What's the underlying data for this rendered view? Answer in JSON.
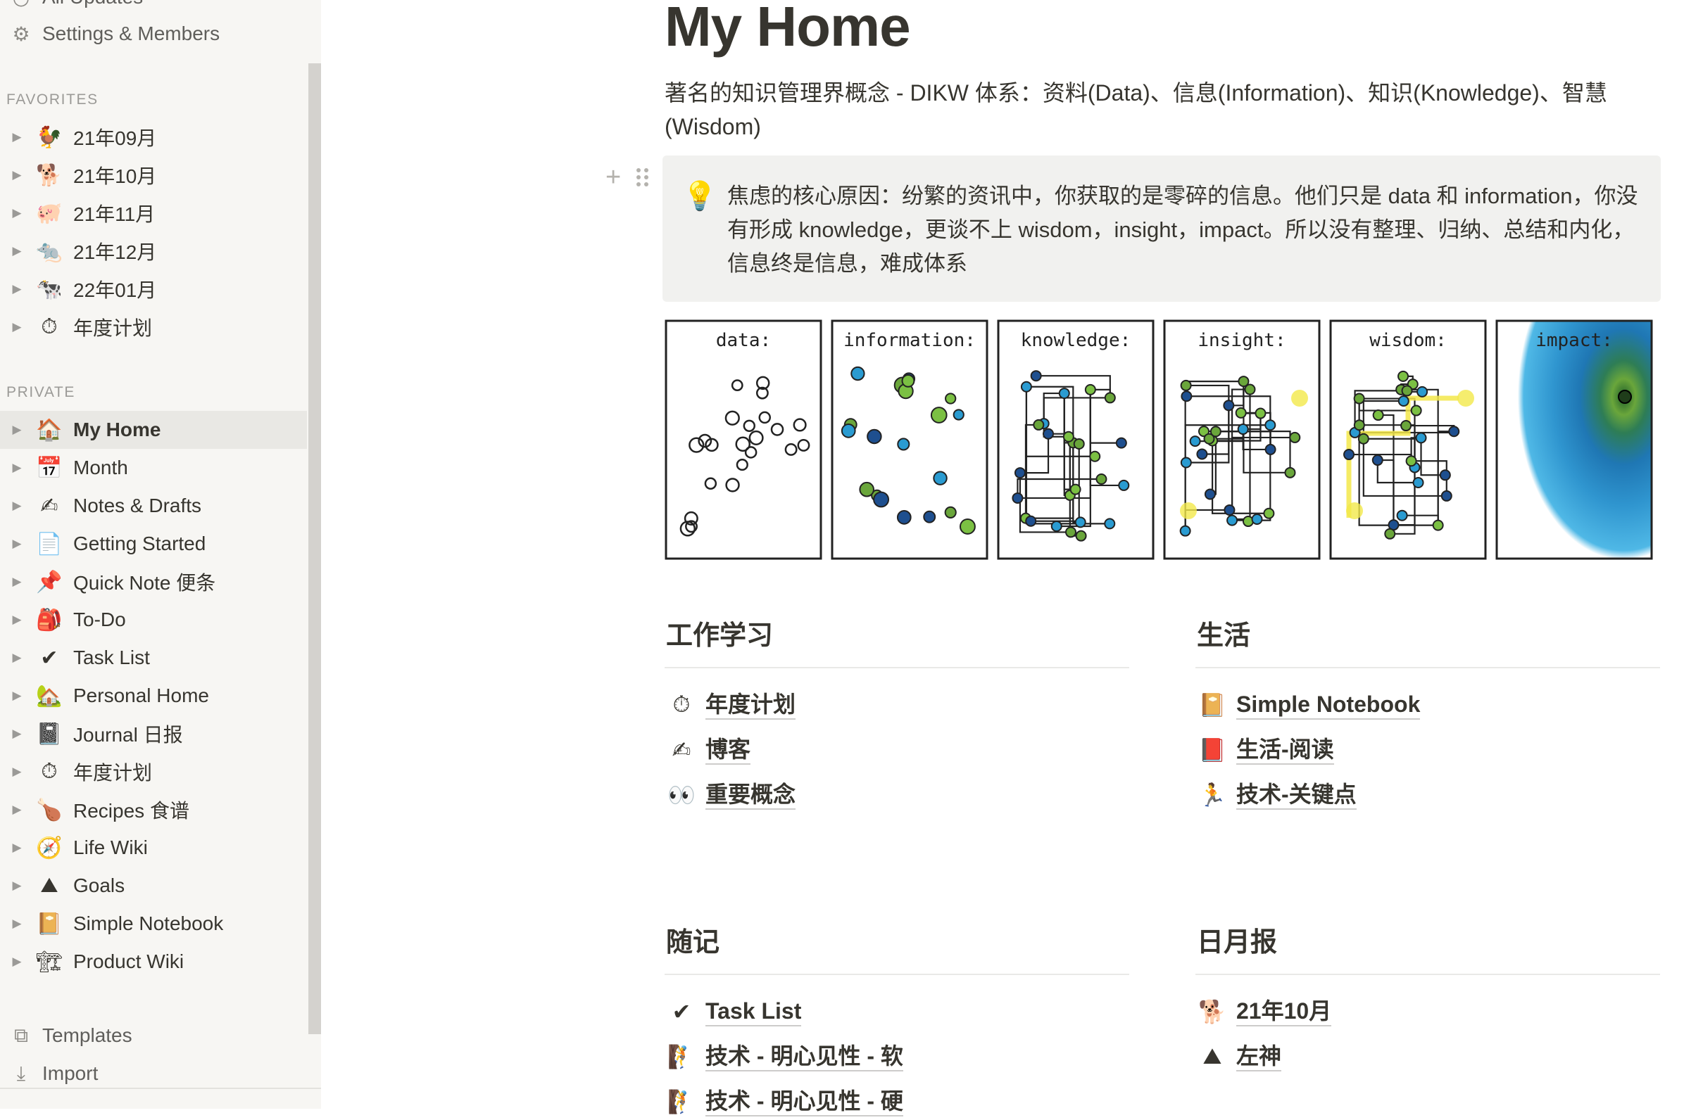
{
  "sidebar": {
    "top_items": [
      {
        "label": "All Updates",
        "icon": "clock-icon"
      },
      {
        "label": "Settings & Members",
        "icon": "gear-icon"
      }
    ],
    "favorites_header": "FAVORITES",
    "favorites": [
      {
        "emoji": "🐓",
        "label": "21年09月"
      },
      {
        "emoji": "🐕",
        "label": "21年10月"
      },
      {
        "emoji": "🐖",
        "label": "21年11月"
      },
      {
        "emoji": "🐀",
        "label": "21年12月"
      },
      {
        "emoji": "🐄",
        "label": "22年01月"
      },
      {
        "emoji": "⏱",
        "label": "年度计划"
      }
    ],
    "private_header": "PRIVATE",
    "private": [
      {
        "emoji": "🏠",
        "label": "My Home",
        "active": true
      },
      {
        "emoji": "📅",
        "label": "Month"
      },
      {
        "emoji": "✍",
        "label": "Notes & Drafts"
      },
      {
        "emoji": "📄",
        "label": "Getting Started"
      },
      {
        "emoji": "📌",
        "label": "Quick Note 便条"
      },
      {
        "emoji": "🎒",
        "label": "To-Do"
      },
      {
        "emoji": "✔",
        "label": "Task List"
      },
      {
        "emoji": "🏡",
        "label": "Personal Home"
      },
      {
        "emoji": "📓",
        "label": "Journal 日报"
      },
      {
        "emoji": "⏱",
        "label": "年度计划"
      },
      {
        "emoji": "🍗",
        "label": "Recipes 食谱"
      },
      {
        "emoji": "🧭",
        "label": "Life Wiki"
      },
      {
        "emoji": "⛰",
        "label": "Goals"
      },
      {
        "emoji": "📔",
        "label": "Simple Notebook"
      },
      {
        "emoji": "🏗",
        "label": "Product Wiki"
      }
    ],
    "bottom_items": [
      {
        "label": "Templates",
        "icon": "templates-icon"
      },
      {
        "label": "Import",
        "icon": "import-icon"
      }
    ]
  },
  "main": {
    "title": "My Home",
    "description": "著名的知识管理界概念 - DIKW 体系：资料(Data)、信息(Information)、知识(Knowledge)、智慧(Wisdom)",
    "callout": {
      "icon": "lightbulb-icon",
      "text": "焦虑的核心原因：纷繁的资讯中，你获取的是零碎的信息。他们只是 data 和 information，你没有形成 knowledge，更谈不上 wisdom，insight，impact。所以没有整理、归纳、总结和内化，信息终是信息，难成体系"
    },
    "dikw_panels": [
      "data:",
      "information:",
      "knowledge:",
      "insight:",
      "wisdom:",
      "impact:"
    ],
    "sections": [
      {
        "title": "工作学习",
        "links": [
          {
            "emoji": "⏱",
            "label": "年度计划"
          },
          {
            "emoji": "✍",
            "label": "博客"
          },
          {
            "emoji": "👀",
            "label": "重要概念"
          }
        ]
      },
      {
        "title": "生活",
        "links": [
          {
            "emoji": "📔",
            "label": "Simple Notebook"
          },
          {
            "emoji": "📕",
            "label": "生活-阅读"
          },
          {
            "emoji": "🏃",
            "label": "技术-关键点"
          }
        ]
      },
      {
        "title": "随记",
        "links": [
          {
            "emoji": "✔",
            "label": "Task List"
          },
          {
            "emoji": "🧗",
            "label": "技术 - 明心见性 - 软"
          },
          {
            "emoji": "🧗",
            "label": "技术 - 明心见性 - 硬"
          }
        ]
      },
      {
        "title": "日月报",
        "links": [
          {
            "emoji": "🐕",
            "label": "21年10月"
          },
          {
            "emoji": "⛰",
            "label": "左神"
          }
        ]
      }
    ]
  }
}
